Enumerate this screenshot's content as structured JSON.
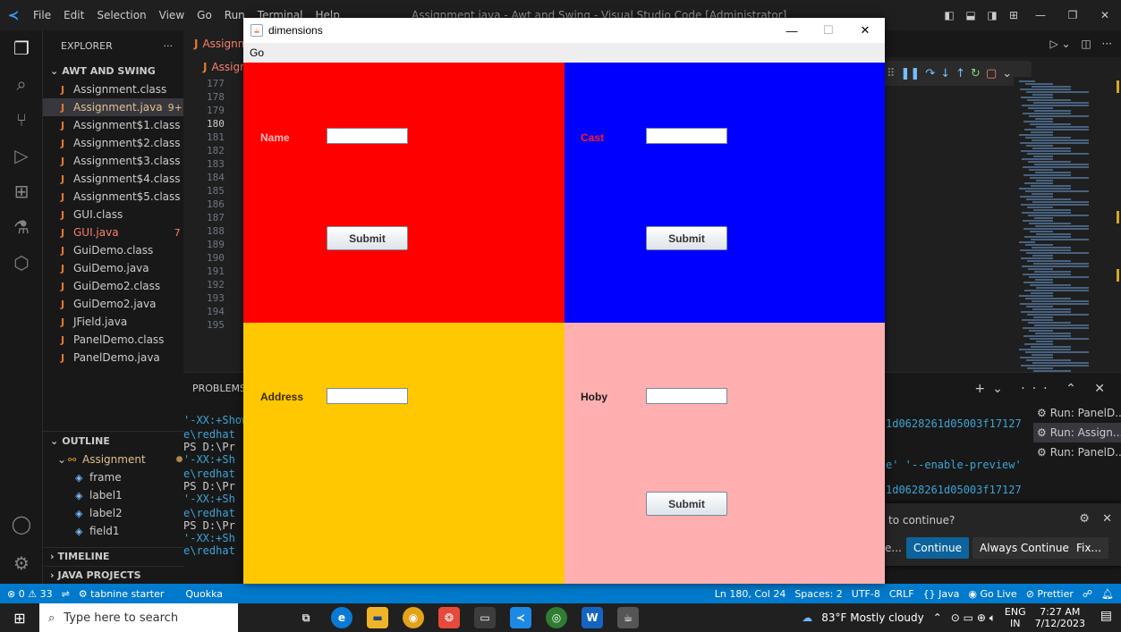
{
  "vscode": {
    "menu": [
      "File",
      "Edit",
      "Selection",
      "View",
      "Go",
      "Run",
      "Terminal",
      "Help"
    ],
    "window_title": "Assignment.java - Awt and Swing - Visual Studio Code [Administrator]",
    "explorer": {
      "header": "EXPLORER",
      "more": "···",
      "folder": "AWT AND SWING",
      "files": [
        {
          "name": "Assignment.class",
          "state": "normal",
          "badge": ""
        },
        {
          "name": "Assignment.java",
          "state": "modified",
          "badge": "9+"
        },
        {
          "name": "Assignment$1.class",
          "state": "normal",
          "badge": ""
        },
        {
          "name": "Assignment$2.class",
          "state": "normal",
          "badge": ""
        },
        {
          "name": "Assignment$3.class",
          "state": "normal",
          "badge": ""
        },
        {
          "name": "Assignment$4.class",
          "state": "normal",
          "badge": ""
        },
        {
          "name": "Assignment$5.class",
          "state": "normal",
          "badge": ""
        },
        {
          "name": "GUI.class",
          "state": "normal",
          "badge": ""
        },
        {
          "name": "GUI.java",
          "state": "error",
          "badge": "7"
        },
        {
          "name": "GuiDemo.class",
          "state": "normal",
          "badge": ""
        },
        {
          "name": "GuiDemo.java",
          "state": "normal",
          "badge": ""
        },
        {
          "name": "GuiDemo2.class",
          "state": "normal",
          "badge": ""
        },
        {
          "name": "GuiDemo2.java",
          "state": "normal",
          "badge": ""
        },
        {
          "name": "JField.java",
          "state": "normal",
          "badge": ""
        },
        {
          "name": "PanelDemo.class",
          "state": "normal",
          "badge": ""
        },
        {
          "name": "PanelDemo.java",
          "state": "normal",
          "badge": ""
        }
      ],
      "outline_header": "OUTLINE",
      "outline_root": "Assignment",
      "outline_items": [
        "frame",
        "label1",
        "label2",
        "field1"
      ],
      "timeline": "TIMELINE",
      "java_projects": "JAVA PROJECTS"
    },
    "tab_label": "Assignment.java",
    "breadcrumb": "Assignment.java",
    "line_numbers": [
      "177",
      "178",
      "179",
      "180",
      "181",
      "182",
      "183",
      "184",
      "185",
      "186",
      "187",
      "188",
      "189",
      "190",
      "191",
      "192",
      "193",
      "194",
      "195"
    ],
    "panel": {
      "tab": "PROBLEMS",
      "terminal_lines": [
        "'-XX:+ShowCodeDetailsInExceptionMessages'",
        "e\\redhat",
        "PS D:\\Pr",
        "'-XX:+Sh",
        "e\\redhat",
        "PS D:\\Pr",
        "'-XX:+Sh",
        "e\\redhat",
        "PS D:\\Pr",
        "'-XX:+Sh",
        "e\\redhat"
      ],
      "right_lines": [
        "1d0628261d05003f17127",
        "e' '--enable-preview'",
        "1d0628261d05003f17127",
        "e' '--enable-preview'"
      ],
      "terminals": [
        "Run: PanelD...",
        "Run: Assign...",
        "Run: PanelD..."
      ]
    },
    "toast": {
      "message": "to continue?",
      "ellipsis": "e...",
      "continue": "Continue",
      "always_continue": "Always Continue",
      "fix": "Fix..."
    },
    "status": {
      "errors": "⊗ 0 ⚠ 33",
      "tabnine": "tabnine starter",
      "quokka": "Quokka",
      "position": "Ln 180, Col 24",
      "spaces": "Spaces: 2",
      "encoding": "UTF-8",
      "eol": "CRLF",
      "language": "{} Java",
      "golive": "Go Live",
      "prettier": "⊘ Prettier"
    }
  },
  "taskbar": {
    "search_placeholder": "Type here to search",
    "weather": "83°F  Mostly cloudy",
    "lang_top": "ENG",
    "lang_bottom": "IN",
    "time": "7:27 AM",
    "date": "7/12/2023"
  },
  "java_window": {
    "title": "dimensions",
    "menu": "Go",
    "panels": [
      {
        "color": "#ff0000",
        "label": "Name",
        "label_color": "#ffbdbd",
        "button": "Submit"
      },
      {
        "color": "#0000ff",
        "label": "Cast",
        "label_color": "#ff1a1a",
        "button": "Submit"
      },
      {
        "color": "#ffc800",
        "label": "Address",
        "label_color": "#3a2a00",
        "button": ""
      },
      {
        "color": "#ffafaf",
        "label": "Hoby",
        "label_color": "#1a1a1a",
        "button": "Submit"
      }
    ]
  }
}
